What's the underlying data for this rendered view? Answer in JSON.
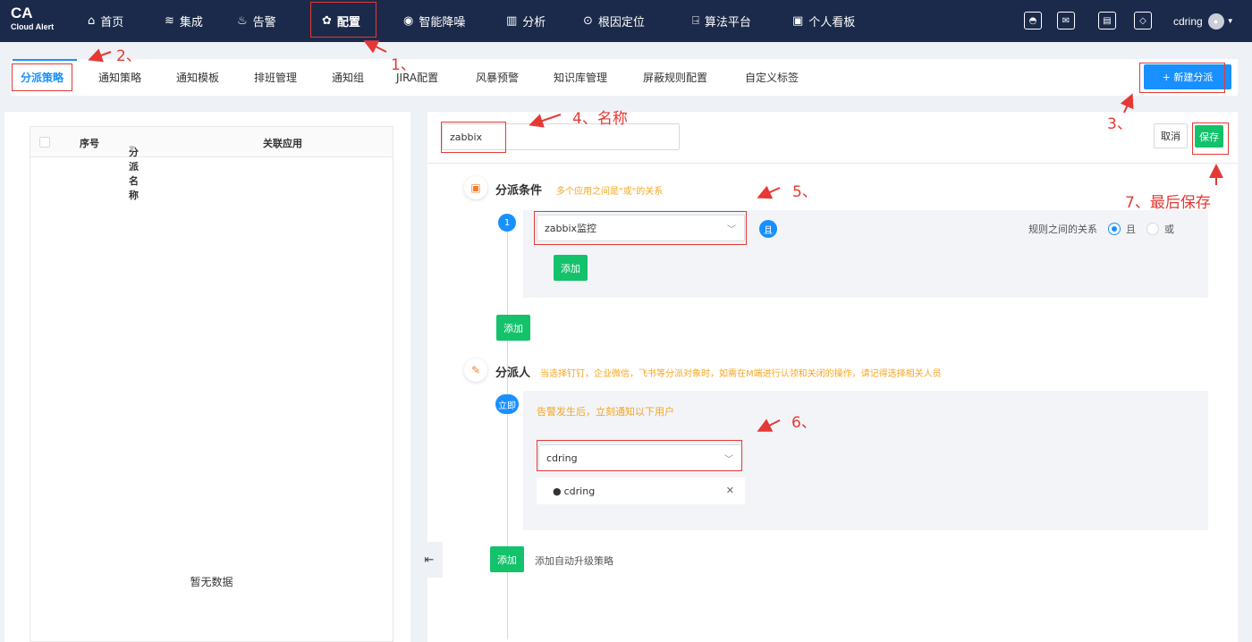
{
  "brand": {
    "short": "CA",
    "name": "Cloud Alert"
  },
  "nav": [
    {
      "icon": "home-icon",
      "glyph": "⌂",
      "label": "首页"
    },
    {
      "icon": "layers-icon",
      "glyph": "≋",
      "label": "集成"
    },
    {
      "icon": "alarm-icon",
      "glyph": "♨",
      "label": "告警"
    },
    {
      "icon": "gear-icon",
      "glyph": "✿",
      "label": "配置"
    },
    {
      "icon": "noise-reduction-icon",
      "glyph": "◉",
      "label": "智能降噪"
    },
    {
      "icon": "analysis-icon",
      "glyph": "▥",
      "label": "分析"
    },
    {
      "icon": "locate-icon",
      "glyph": "⊙",
      "label": "根因定位"
    },
    {
      "icon": "algorithm-icon",
      "glyph": "⍈",
      "label": "算法平台"
    },
    {
      "icon": "dashboard-icon",
      "glyph": "▣",
      "label": "个人看板"
    }
  ],
  "header": {
    "username": "cdring"
  },
  "tabs": [
    "分派策略",
    "通知策略",
    "通知模板",
    "排班管理",
    "通知组",
    "JIRA配置",
    "风暴预警",
    "知识库管理",
    "屏蔽规则配置",
    "自定义标签"
  ],
  "new_button": "+ 新建分派",
  "list": {
    "headers": {
      "index": "序号",
      "name": "分派名称",
      "app": "关联应用"
    },
    "empty_text": "暂无数据"
  },
  "editor": {
    "name_value": "zabbix",
    "cancel": "取消",
    "save": "保存",
    "conditions": {
      "title": "分派条件",
      "hint": "多个应用之间是\"或\"的关系",
      "rule_number": "1",
      "app_selected": "zabbix监控",
      "and_badge": "且",
      "relation_label": "规则之间的关系",
      "relation_options": [
        "且",
        "或"
      ],
      "inner_add": "添加",
      "outer_add": "添加"
    },
    "assignee": {
      "title": "分派人",
      "hint": "当选择钉钉，企业微信，飞书等分派对象时，如需在M端进行认领和关闭的操作，请记得选择相关人员",
      "immediate_badge": "立即",
      "immediate_text": "告警发生后，立刻通知以下用户",
      "user_selected": "cdring",
      "user_tag": "cdring",
      "add_button": "添加",
      "add_escalation": "添加自动升级策略"
    }
  },
  "annotations": [
    "1、",
    "2、",
    "3、",
    "4、名称",
    "5、",
    "6、",
    "7、最后保存"
  ],
  "colors": {
    "nav_bg": "#1b2a4a",
    "primary": "#1890ff",
    "success": "#13c26b",
    "warning": "#f5a623",
    "annotation": "#e53935"
  }
}
